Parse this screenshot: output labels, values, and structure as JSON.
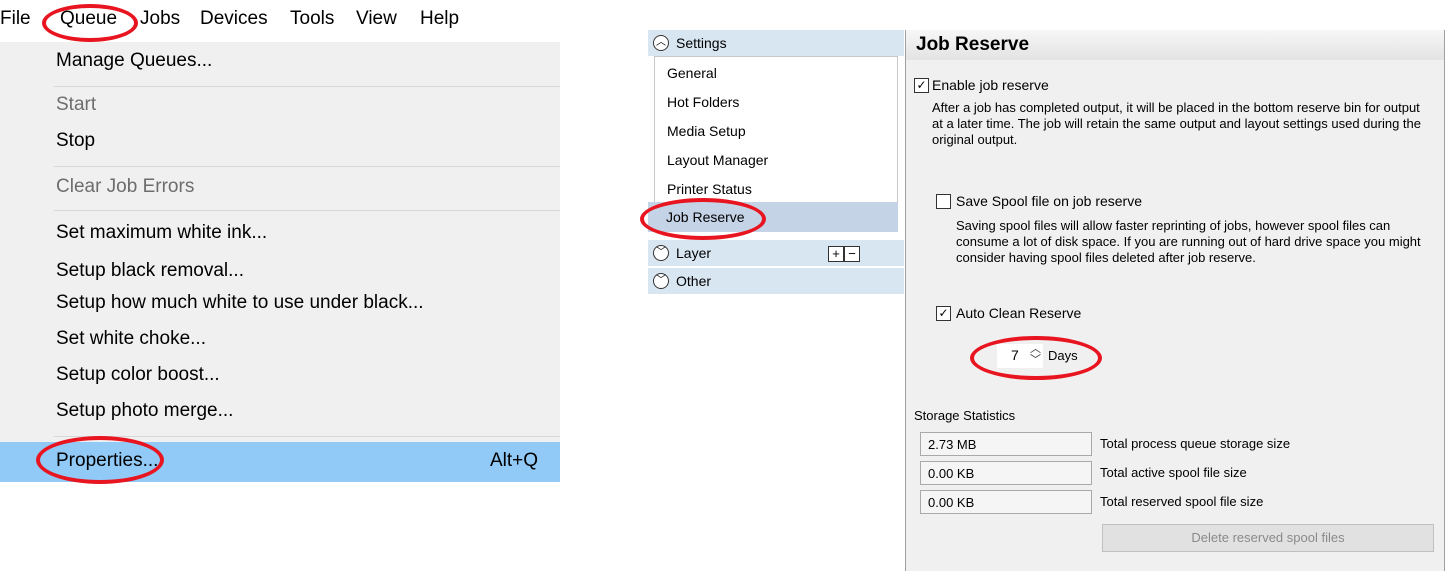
{
  "menubar": {
    "items": [
      "File",
      "Queue",
      "Jobs",
      "Devices",
      "Tools",
      "View",
      "Help"
    ]
  },
  "queue_menu": {
    "manage_queues": "Manage Queues...",
    "start": "Start",
    "stop": "Stop",
    "clear_job_errors": "Clear Job Errors",
    "set_max_white_ink": "Set maximum white ink...",
    "setup_black_removal": "Setup black removal...",
    "setup_white_under_black": "Setup how much white to use under black...",
    "set_white_choke": "Set white choke...",
    "setup_color_boost": "Setup color boost...",
    "setup_photo_merge": "Setup photo merge...",
    "properties": "Properties...",
    "properties_shortcut": "Alt+Q"
  },
  "tree": {
    "settings_label": "Settings",
    "settings_items": [
      "General",
      "Hot Folders",
      "Media Setup",
      "Layout Manager",
      "Printer Status",
      "Job Reserve"
    ],
    "layer_label": "Layer",
    "other_label": "Other",
    "plus": "+",
    "minus": "−"
  },
  "panel": {
    "title": "Job Reserve",
    "enable_label": "Enable job reserve",
    "enable_checked": true,
    "enable_desc": "After a job has completed output, it will be placed in the bottom reserve bin for output at a later time. The job will retain the same output and layout settings used during the original output.",
    "spool_label": "Save Spool file on job reserve",
    "spool_checked": false,
    "spool_desc": "Saving spool files will allow faster reprinting of jobs, however spool files can consume a lot of disk space. If you are running out of hard drive space you might consider having spool files deleted after job reserve.",
    "auto_clean_label": "Auto Clean Reserve",
    "auto_clean_checked": true,
    "days_value": "7",
    "days_label": "Days",
    "storage_heading": "Storage Statistics",
    "stats": [
      {
        "value": "2.73 MB",
        "label": "Total process queue storage size"
      },
      {
        "value": "0.00 KB",
        "label": "Total active spool file size"
      },
      {
        "value": "0.00 KB",
        "label": "Total reserved spool file size"
      }
    ],
    "delete_button": "Delete reserved spool files"
  },
  "colors": {
    "annotation_red": "#e8141f",
    "menu_highlight": "#91c9f7",
    "tree_selected": "#c5d3e6"
  }
}
